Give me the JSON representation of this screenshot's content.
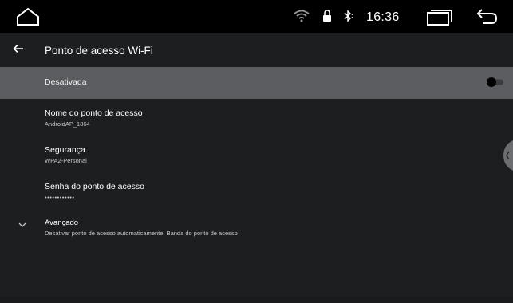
{
  "status_bar": {
    "time": "16:36",
    "icons": [
      "home-icon",
      "wifi-hotspot-icon",
      "lock-icon",
      "bluetooth-icon",
      "recents-icon",
      "back-icon"
    ]
  },
  "header": {
    "title": "Ponto de acesso Wi-Fi"
  },
  "toggle": {
    "label": "Desativada",
    "enabled": false
  },
  "preferences": [
    {
      "title": "Nome do ponto de acesso",
      "summary": "AndroidAP_1864"
    },
    {
      "title": "Segurança",
      "summary": "WPA2-Personal"
    },
    {
      "title": "Senha do ponto de acesso",
      "summary": "••••••••••••"
    }
  ],
  "advanced": {
    "title": "Avançado",
    "summary": "Desativar ponto de acesso automaticamente, Banda do ponto de acesso"
  },
  "colors": {
    "background": "#1d1e20",
    "status_bar": "#000000",
    "toggle_row": "#5b5d60"
  }
}
